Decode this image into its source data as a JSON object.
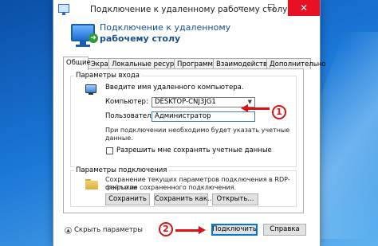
{
  "window": {
    "title": "Подключение к удаленному рабочему столу",
    "header_line1": "Подключение к удаленному",
    "header_line2": "рабочему столу",
    "minimize": "─",
    "maximize": "☐",
    "close": "✕"
  },
  "tabs": [
    {
      "label": "Общие",
      "active": true
    },
    {
      "label": "Экран",
      "active": false
    },
    {
      "label": "Локальные ресурсы",
      "active": false
    },
    {
      "label": "Программы",
      "active": false
    },
    {
      "label": "Взаимодействие",
      "active": false
    },
    {
      "label": "Дополнительно",
      "active": false
    }
  ],
  "logon": {
    "group_title": "Параметры входа",
    "prompt": "Введите имя удаленного компьютера.",
    "computer_label": "Компьютер:",
    "computer_value": "DESKTOP-CNJ3JG1",
    "user_label": "Пользователь:",
    "user_value": "Администратор",
    "note_line1": "При подключении необходимо будет указать учетные",
    "note_line2": "данные.",
    "save_credentials_label": "Разрешить мне сохранять учетные данные",
    "save_credentials_checked": false
  },
  "connection": {
    "group_title": "Параметры подключения",
    "desc_line1": "Сохранение текущих параметров подключения в RDP-файл или",
    "desc_line2": "открытие сохраненного подключения.",
    "save_button": "Сохранить",
    "save_as_button": "Сохранить как...",
    "open_button": "Открыть..."
  },
  "footer": {
    "hide_options": "Скрыть параметры",
    "connect_button": "Подключить",
    "help_button": "Справка"
  },
  "annotations": {
    "marker1": "1",
    "marker2": "2",
    "color": "#dd1111"
  },
  "colors": {
    "accent": "#0078d7",
    "close_button": "#e81123",
    "header_text": "#1a4f8e"
  },
  "icons": {
    "window_icon": "rdp-monitor-icon",
    "header_icon": "rdp-monitor-icon",
    "computer_icon": "computer-icon",
    "user_icon": "user-icon",
    "folder_icon": "folder-icon",
    "hide_options_icon": "chevron-up-icon"
  }
}
